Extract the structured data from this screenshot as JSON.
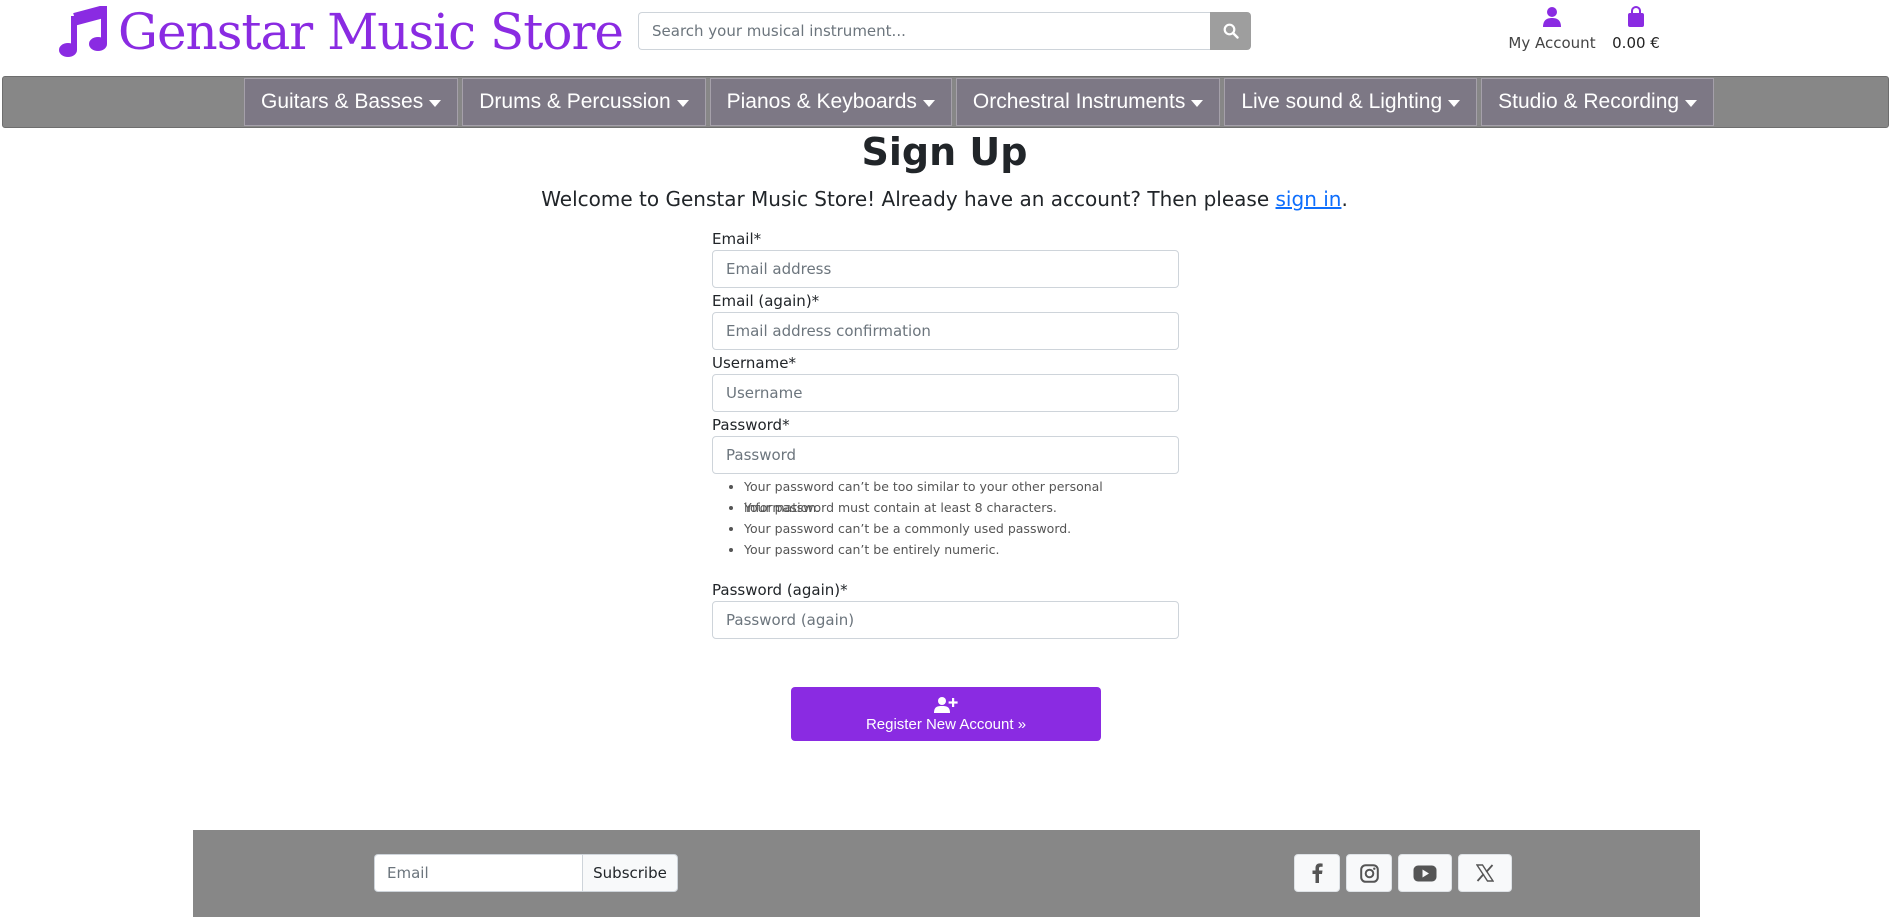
{
  "brand": {
    "name": "Genstar Music Store",
    "color": "#8a2be2"
  },
  "search": {
    "placeholder": "Search your musical instrument..."
  },
  "account": {
    "label": "My Account"
  },
  "cart": {
    "total": "0.00 €"
  },
  "nav": [
    {
      "label": "Guitars & Basses"
    },
    {
      "label": "Drums & Percussion"
    },
    {
      "label": "Pianos & Keyboards"
    },
    {
      "label": "Orchestral Instruments"
    },
    {
      "label": "Live sound & Lighting"
    },
    {
      "label": "Studio & Recording"
    }
  ],
  "page": {
    "title": "Sign Up",
    "welcome_prefix": "Welcome to Genstar Music Store! Already have an account? Then please ",
    "signin_link": "sign in",
    "welcome_suffix": "."
  },
  "form": {
    "email": {
      "label": "Email*",
      "placeholder": "Email address"
    },
    "email2": {
      "label": "Email (again)*",
      "placeholder": "Email address confirmation"
    },
    "username": {
      "label": "Username*",
      "placeholder": "Username"
    },
    "password": {
      "label": "Password*",
      "placeholder": "Password"
    },
    "password_help": [
      "Your password can’t be too similar to your other personal information.",
      "Your password must contain at least 8 characters.",
      "Your password can’t be a commonly used password.",
      "Your password can’t be entirely numeric."
    ],
    "password2": {
      "label": "Password (again)*",
      "placeholder": "Password (again)"
    },
    "submit": "Register New Account »"
  },
  "footer": {
    "newsletter_placeholder": "Email",
    "subscribe": "Subscribe",
    "socials": [
      "facebook-icon",
      "instagram-icon",
      "youtube-icon",
      "x-icon"
    ]
  }
}
